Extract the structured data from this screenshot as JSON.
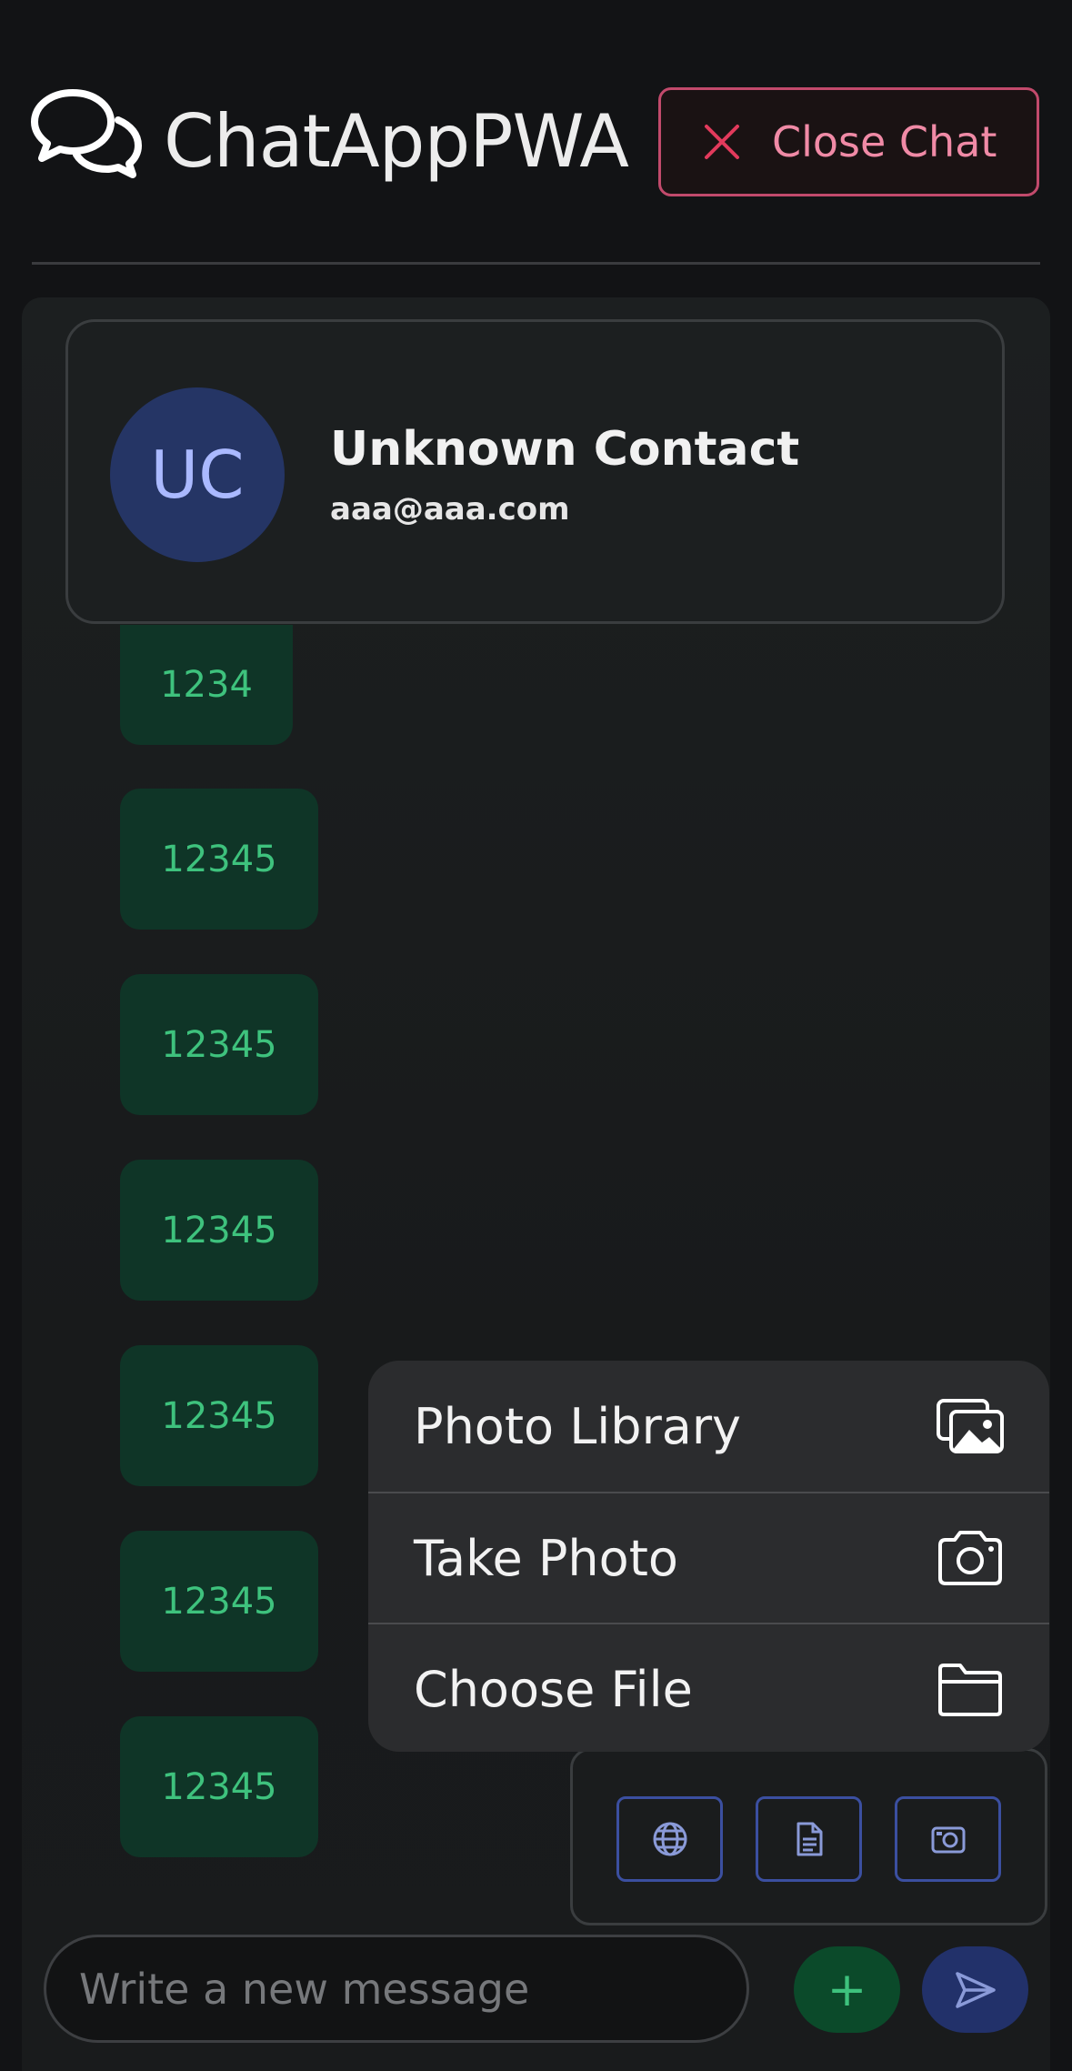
{
  "header": {
    "app_title": "ChatAppPWA",
    "logo_icon": "chat-bubbles-icon",
    "close_label": "Close Chat",
    "close_icon": "close-icon"
  },
  "contact": {
    "initials": "UC",
    "name": "Unknown Contact",
    "email": "aaa@aaa.com"
  },
  "messages": [
    {
      "text": "1234"
    },
    {
      "text": "12345"
    },
    {
      "text": "12345"
    },
    {
      "text": "12345"
    },
    {
      "text": "12345"
    },
    {
      "text": "12345"
    },
    {
      "text": "12345"
    }
  ],
  "action_sheet": {
    "items": [
      {
        "label": "Photo Library",
        "icon": "photo-library-icon"
      },
      {
        "label": "Take Photo",
        "icon": "camera-icon"
      },
      {
        "label": "Choose File",
        "icon": "folder-icon"
      }
    ]
  },
  "quick_actions": [
    {
      "icon": "globe-icon"
    },
    {
      "icon": "document-icon"
    },
    {
      "icon": "camera-icon"
    }
  ],
  "composer": {
    "placeholder": "Write a new message",
    "add_label": "+",
    "send_icon": "send-icon"
  },
  "colors": {
    "accent_green": "#3ec27d",
    "close_pink": "#f08aa6",
    "avatar_bg": "#253565",
    "button_border_blue": "#3b4fa0"
  }
}
